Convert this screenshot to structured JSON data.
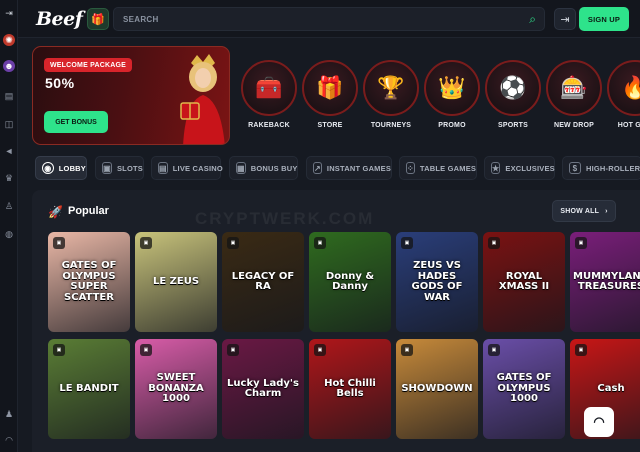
{
  "header": {
    "logo": "Beef",
    "search_placeholder": "SEARCH",
    "signup_label": "SIGN UP"
  },
  "banner": {
    "badge": "WELCOME PACKAGE",
    "percent": "50%",
    "button": "GET BONUS"
  },
  "categories": [
    {
      "label": "RAKEBACK",
      "icon": "treasure-chest",
      "glyph": "🧰"
    },
    {
      "label": "STORE",
      "icon": "store-chest",
      "glyph": "🎁"
    },
    {
      "label": "TOURNEYS",
      "icon": "trophy",
      "glyph": "🏆"
    },
    {
      "label": "PROMO",
      "icon": "crown",
      "glyph": "👑"
    },
    {
      "label": "SPORTS",
      "icon": "soccer-ball",
      "glyph": "⚽"
    },
    {
      "label": "NEW DROP",
      "icon": "new-drop-game",
      "glyph": "🎰"
    },
    {
      "label": "HOT GAM",
      "icon": "hot-game",
      "glyph": "🔥"
    }
  ],
  "tabs": [
    {
      "label": "LOBBY",
      "icon": "compass",
      "glyph": "◉",
      "active": true
    },
    {
      "label": "SLOTS",
      "icon": "slot",
      "glyph": "▣"
    },
    {
      "label": "LIVE CASINO",
      "icon": "live",
      "glyph": "▤"
    },
    {
      "label": "BONUS BUY",
      "icon": "bonus",
      "glyph": "▦"
    },
    {
      "label": "INSTANT GAMES",
      "icon": "instant",
      "glyph": "↗"
    },
    {
      "label": "TABLE GAMES",
      "icon": "dice",
      "glyph": "⁘"
    },
    {
      "label": "EXCLUSIVES",
      "icon": "star",
      "glyph": "★"
    },
    {
      "label": "HIGH-ROLLER",
      "icon": "dollar",
      "glyph": "$"
    }
  ],
  "popular": {
    "title": "Popular",
    "show_all": "SHOW ALL",
    "watermark": "CRYPTWERK.COM"
  },
  "games_row1": [
    {
      "title": "GATES OF OLYMPUS SUPER SCATTER",
      "bg": "#e9b7a6"
    },
    {
      "title": "LE ZEUS",
      "bg": "#c8c37b"
    },
    {
      "title": "LEGACY OF RA",
      "bg": "#3a2a14"
    },
    {
      "title": "Donny & Danny",
      "bg": "#2f6b1f"
    },
    {
      "title": "ZEUS VS HADES GODS OF WAR",
      "bg": "#2a3e7a"
    },
    {
      "title": "ROYAL XMASS II",
      "bg": "#7a1212"
    },
    {
      "title": "MUMMYLAND TREASURES",
      "bg": "#7a1e7a"
    }
  ],
  "games_row2": [
    {
      "title": "LE BANDIT",
      "bg": "#5a7d35"
    },
    {
      "title": "SWEET BONANZA 1000",
      "bg": "#d85ca8"
    },
    {
      "title": "Lucky Lady's Charm",
      "bg": "#6a1844"
    },
    {
      "title": "Hot Chilli Bells",
      "bg": "#b0161a"
    },
    {
      "title": "SHOWDOWN",
      "bg": "#c78a3a"
    },
    {
      "title": "GATES OF OLYMPUS 1000",
      "bg": "#6a4ea8"
    },
    {
      "title": "Cash",
      "bg": "#c81616"
    }
  ]
}
